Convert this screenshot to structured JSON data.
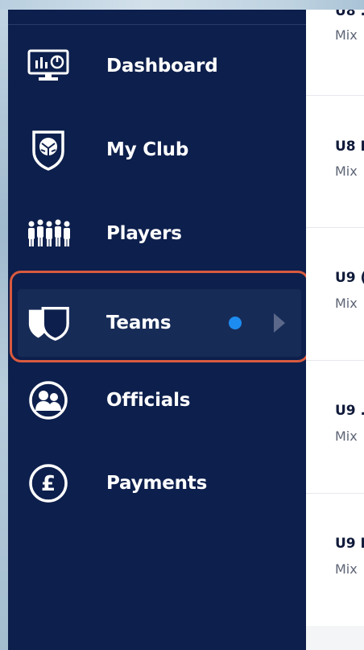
{
  "sidebar": {
    "items": [
      {
        "label": "Dashboard",
        "icon": "dashboard-icon"
      },
      {
        "label": "My Club",
        "icon": "club-crest-icon"
      },
      {
        "label": "Players",
        "icon": "players-icon"
      },
      {
        "label": "Teams",
        "icon": "teams-icon",
        "active": true,
        "indicator": "new-dot"
      },
      {
        "label": "Officials",
        "icon": "officials-icon"
      },
      {
        "label": "Payments",
        "icon": "pound-icon"
      }
    ]
  },
  "teams_list": {
    "rows": [
      {
        "title": "U8 .",
        "subtitle": "Mix"
      },
      {
        "title": "U8 I",
        "subtitle": "Mix"
      },
      {
        "title": "U9 (",
        "subtitle": "Mix"
      },
      {
        "title": "U9 .",
        "subtitle": "Mix"
      },
      {
        "title": "U9 I",
        "subtitle": "Mix"
      }
    ]
  },
  "colors": {
    "sidebar_bg": "#0d1f4c",
    "active_bg": "#172b57",
    "highlight_outline": "#d85a3f",
    "indicator_dot": "#1d8cf0",
    "chevron": "#5b6889"
  }
}
